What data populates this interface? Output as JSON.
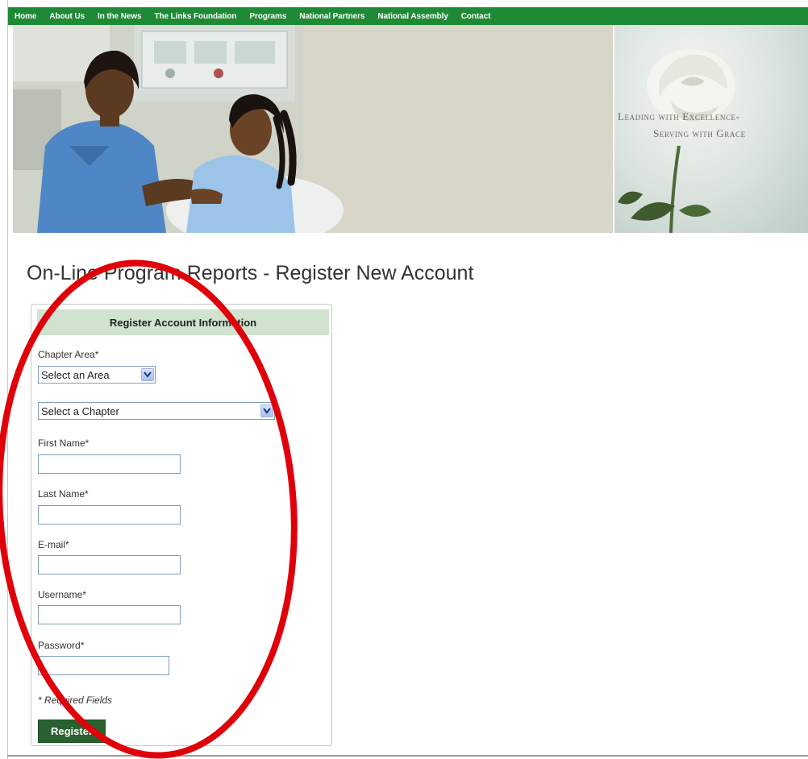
{
  "nav": {
    "items": [
      "Home",
      "About Us",
      "In the News",
      "The Links Foundation",
      "Programs",
      "National Partners",
      "National Assembly",
      "Contact"
    ]
  },
  "banner": {
    "tagline_line1": "Leading with Excellence-",
    "tagline_line2": "Serving with Grace"
  },
  "page": {
    "title": "On-Line Program Reports - Register New Account"
  },
  "form": {
    "header": "Register Account Information",
    "chapter_area_label": "Chapter Area*",
    "area_select_value": "Select an Area",
    "chapter_select_value": "Select a Chapter",
    "first_name_label": "First Name*",
    "last_name_label": "Last Name*",
    "email_label": "E-mail*",
    "username_label": "Username*",
    "password_label": "Password*",
    "required_note": "* Required Fields",
    "submit_label": "Register"
  },
  "colors": {
    "nav_bg": "#1f8a35",
    "panel_header_bg": "#cfe3cf",
    "button_bg": "#28602e",
    "annotation": "#e0000a"
  }
}
